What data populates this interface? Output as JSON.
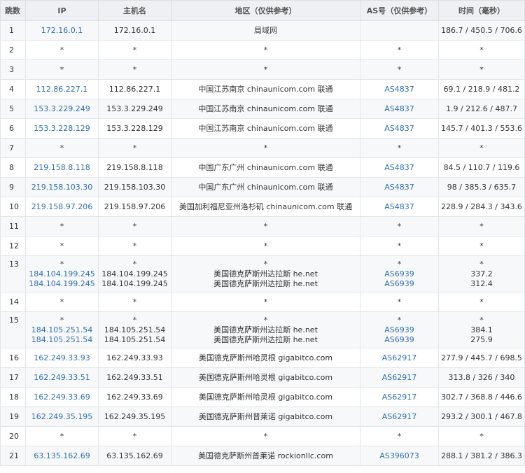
{
  "headers": [
    "跳数",
    "IP",
    "主机名",
    "地区（仅供参考）",
    "AS号（仅供参考）",
    "时间（毫秒）"
  ],
  "rows": [
    {
      "hop": "1",
      "ip": [
        "172.16.0.1"
      ],
      "host": [
        "172.16.0.1"
      ],
      "region": [
        "局域网"
      ],
      "as": [
        ""
      ],
      "time": [
        "186.7 / 450.5 / 706.6"
      ]
    },
    {
      "hop": "2",
      "ip": [
        "*"
      ],
      "host": [
        "*"
      ],
      "region": [
        "*"
      ],
      "as": [
        "*"
      ],
      "time": [
        "*"
      ]
    },
    {
      "hop": "3",
      "ip": [
        "*"
      ],
      "host": [
        "*"
      ],
      "region": [
        "*"
      ],
      "as": [
        "*"
      ],
      "time": [
        "*"
      ]
    },
    {
      "hop": "4",
      "ip": [
        "112.86.227.1"
      ],
      "host": [
        "112.86.227.1"
      ],
      "region": [
        "中国江苏南京 chinaunicom.com 联通"
      ],
      "as": [
        "AS4837"
      ],
      "time": [
        "69.1 / 218.9 / 481.2"
      ]
    },
    {
      "hop": "5",
      "ip": [
        "153.3.229.249"
      ],
      "host": [
        "153.3.229.249"
      ],
      "region": [
        "中国江苏南京 chinaunicom.com 联通"
      ],
      "as": [
        "AS4837"
      ],
      "time": [
        "1.9 / 212.6 / 487.7"
      ]
    },
    {
      "hop": "6",
      "ip": [
        "153.3.228.129"
      ],
      "host": [
        "153.3.228.129"
      ],
      "region": [
        "中国江苏南京 chinaunicom.com 联通"
      ],
      "as": [
        "AS4837"
      ],
      "time": [
        "145.7 / 401.3 / 553.6"
      ]
    },
    {
      "hop": "7",
      "ip": [
        "*"
      ],
      "host": [
        "*"
      ],
      "region": [
        "*"
      ],
      "as": [
        "*"
      ],
      "time": [
        "*"
      ]
    },
    {
      "hop": "8",
      "ip": [
        "219.158.8.118"
      ],
      "host": [
        "219.158.8.118"
      ],
      "region": [
        "中国广东广州 chinaunicom.com 联通"
      ],
      "as": [
        "AS4837"
      ],
      "time": [
        "84.5 / 110.7 / 119.6"
      ]
    },
    {
      "hop": "9",
      "ip": [
        "219.158.103.30"
      ],
      "host": [
        "219.158.103.30"
      ],
      "region": [
        "中国广东广州 chinaunicom.com 联通"
      ],
      "as": [
        "AS4837"
      ],
      "time": [
        "98 / 385.3 / 635.7"
      ]
    },
    {
      "hop": "10",
      "ip": [
        "219.158.97.206"
      ],
      "host": [
        "219.158.97.206"
      ],
      "region": [
        "美国加利福尼亚州洛杉矶 chinaunicom.com 联通"
      ],
      "as": [
        "AS4837"
      ],
      "time": [
        "228.9 / 284.3 / 343.6"
      ]
    },
    {
      "hop": "11",
      "ip": [
        "*"
      ],
      "host": [
        "*"
      ],
      "region": [
        "*"
      ],
      "as": [
        "*"
      ],
      "time": [
        "*"
      ]
    },
    {
      "hop": "12",
      "ip": [
        "*"
      ],
      "host": [
        "*"
      ],
      "region": [
        "*"
      ],
      "as": [
        "*"
      ],
      "time": [
        "*"
      ]
    },
    {
      "hop": "13",
      "ip": [
        "*",
        "184.104.199.245",
        "184.104.199.245"
      ],
      "host": [
        "*",
        "184.104.199.245",
        "184.104.199.245"
      ],
      "region": [
        "*",
        "美国德克萨斯州达拉斯 he.net",
        "美国德克萨斯州达拉斯 he.net"
      ],
      "as": [
        "*",
        "AS6939",
        "AS6939"
      ],
      "time": [
        "*",
        "337.2",
        "312.4"
      ]
    },
    {
      "hop": "14",
      "ip": [
        "*"
      ],
      "host": [
        "*"
      ],
      "region": [
        "*"
      ],
      "as": [
        "*"
      ],
      "time": [
        "*"
      ]
    },
    {
      "hop": "15",
      "ip": [
        "*",
        "184.105.251.54",
        "184.105.251.54"
      ],
      "host": [
        "*",
        "184.105.251.54",
        "184.105.251.54"
      ],
      "region": [
        "*",
        "美国德克萨斯州达拉斯 he.net",
        "美国德克萨斯州达拉斯 he.net"
      ],
      "as": [
        "*",
        "AS6939",
        "AS6939"
      ],
      "time": [
        "*",
        "384.1",
        "275.9"
      ]
    },
    {
      "hop": "16",
      "ip": [
        "162.249.33.93"
      ],
      "host": [
        "162.249.33.93"
      ],
      "region": [
        "美国德克萨斯州哈灵根 gigabitco.com"
      ],
      "as": [
        "AS62917"
      ],
      "time": [
        "277.9 / 445.7 / 698.5"
      ]
    },
    {
      "hop": "17",
      "ip": [
        "162.249.33.51"
      ],
      "host": [
        "162.249.33.51"
      ],
      "region": [
        "美国德克萨斯州哈灵根 gigabitco.com"
      ],
      "as": [
        "AS62917"
      ],
      "time": [
        "313.8 / 326 / 340"
      ]
    },
    {
      "hop": "18",
      "ip": [
        "162.249.33.69"
      ],
      "host": [
        "162.249.33.69"
      ],
      "region": [
        "美国德克萨斯州哈灵根 gigabitco.com"
      ],
      "as": [
        "AS62917"
      ],
      "time": [
        "302.7 / 368.8 / 446.6"
      ]
    },
    {
      "hop": "19",
      "ip": [
        "162.249.35.195"
      ],
      "host": [
        "162.249.35.195"
      ],
      "region": [
        "美国德克萨斯州普莱诺 gigabitco.com"
      ],
      "as": [
        "AS62917"
      ],
      "time": [
        "293.2 / 300.1 / 467.8"
      ]
    },
    {
      "hop": "20",
      "ip": [
        "*"
      ],
      "host": [
        "*"
      ],
      "region": [
        "*"
      ],
      "as": [
        "*"
      ],
      "time": [
        "*"
      ]
    },
    {
      "hop": "21",
      "ip": [
        "63.135.162.69"
      ],
      "host": [
        "63.135.162.69"
      ],
      "region": [
        "美国德克萨斯州普莱诺 rockionllc.com"
      ],
      "as": [
        "AS396073"
      ],
      "time": [
        "288.1 / 381.2 / 386.3"
      ]
    }
  ],
  "colors": {
    "link": "#2f6fb3",
    "header_bg": "#eef0f3",
    "stripe": "#f7f8fa",
    "border": "#e2e5e8"
  }
}
